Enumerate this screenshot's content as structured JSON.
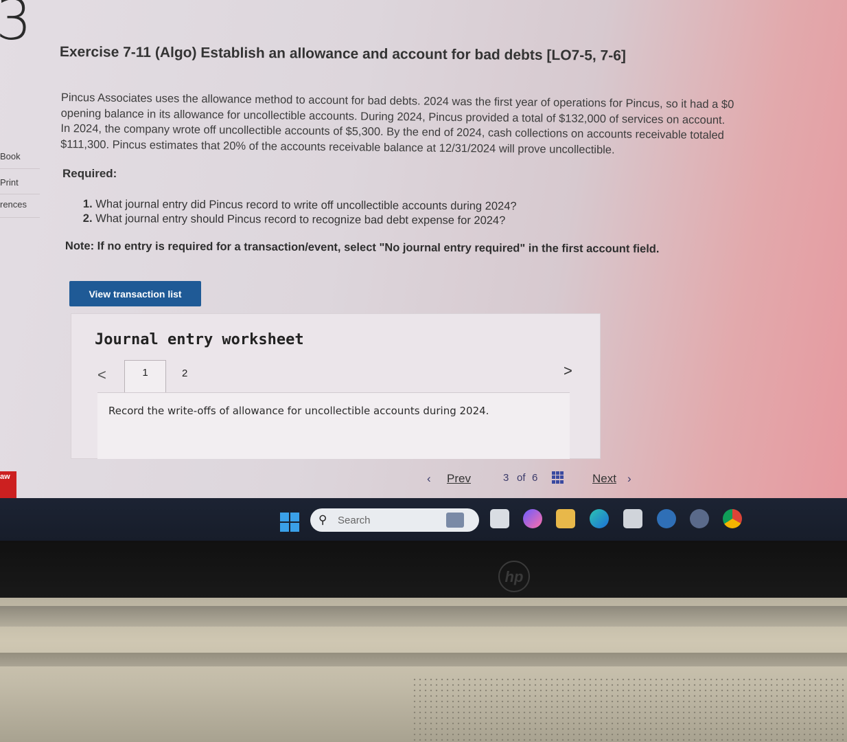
{
  "page_number": "3",
  "sidebar": {
    "links": [
      "Book",
      "Print",
      "rences"
    ],
    "logo_text": "aw"
  },
  "exercise": {
    "title": "Exercise 7-11 (Algo) Establish an allowance and account for bad debts [LO7-5, 7-6]",
    "problem_lines": [
      "Pincus Associates uses the allowance method to account for bad debts. 2024 was the first year of operations for Pincus, so it had a $0",
      "opening balance in its allowance for uncollectible accounts. During 2024, Pincus provided a total of $132,000 of services on account.",
      "In 2024, the company wrote off uncollectible accounts of $5,300. By the end of 2024, cash collections on accounts receivable totaled",
      "$111,300. Pincus estimates that 20% of the accounts receivable balance at 12/31/2024 will prove uncollectible."
    ],
    "required_label": "Required:",
    "requirements": [
      {
        "num": "1.",
        "text": "What journal entry did Pincus record to write off uncollectible accounts during 2024?"
      },
      {
        "num": "2.",
        "text": "What journal entry should Pincus record to recognize bad debt expense for 2024?"
      }
    ],
    "note": "Note: If no entry is required for a transaction/event, select \"No journal entry required\" in the first account field."
  },
  "view_transactions_label": "View transaction list",
  "worksheet": {
    "title": "Journal entry worksheet",
    "prev_glyph": "<",
    "next_glyph": ">",
    "tabs": [
      "1",
      "2"
    ],
    "active_tab": "1",
    "instruction": "Record the write-offs of allowance for uncollectible accounts during 2024."
  },
  "pager": {
    "prev_label": "Prev",
    "current": "3",
    "of_label": "of",
    "total": "6",
    "next_label": "Next"
  },
  "taskbar": {
    "search_placeholder": "Search",
    "icons": [
      "windows-start-icon",
      "search-icon",
      "widgets-icon",
      "file-icon",
      "copilot-icon",
      "folder-icon",
      "edge-icon",
      "calculator-icon",
      "help-icon",
      "settings-icon",
      "chrome-icon"
    ]
  },
  "brand_logo": "hp",
  "colors": {
    "primary_button": "#1f5a96",
    "pager_link": "#333333"
  }
}
